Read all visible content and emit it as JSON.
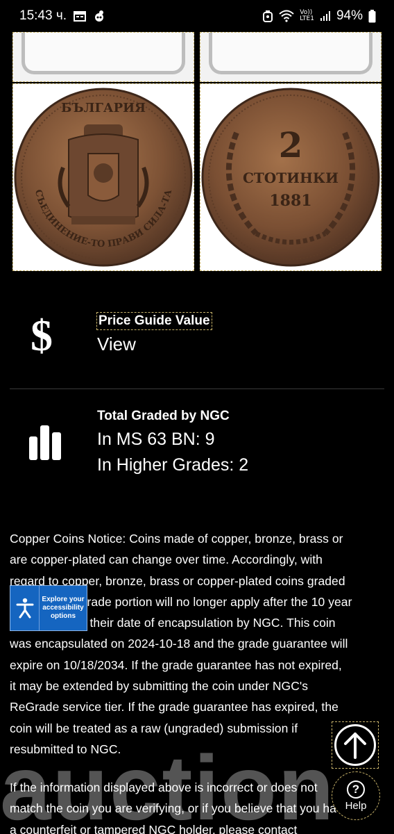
{
  "status_bar": {
    "time": "15:43 ч.",
    "network_top": "Vo))",
    "network_bottom": "LTE1",
    "battery": "94%"
  },
  "coin": {
    "obverse_legend": "БЪЛГАРИЯ",
    "obverse_motto": "СЪЕДИНЕНИЕ-ТО ПРАВИ СИЛА-ТА",
    "reverse_value": "2",
    "reverse_denomination": "СТОТИНКИ",
    "reverse_year": "1881"
  },
  "price_guide": {
    "title": "Price Guide Value",
    "link": "View",
    "icon": "dollar-icon"
  },
  "graded": {
    "title": "Total Graded by NGC",
    "line1": "In MS 63 BN: 9",
    "line2": "In Higher Grades: 2",
    "icon": "bar-chart-icon"
  },
  "notice": {
    "line1": "Copper Coins Notice: Coins made of copper, bronze, brass or",
    "line2": "are copper-plated can change over time. Accordingly, with",
    "line3": "regard to copper, bronze, brass or copper-plated coins graded",
    "line4": "by NGC, the grade portion will no longer apply after the 10 year",
    "line5": "anniversary of their date of encapsulation by NGC. This coin",
    "line6": "was encapsulated on 2024-10-18 and the grade guarantee will",
    "line7": "expire on 10/18/2034. If the grade guarantee has not expired,",
    "line8": "it may be extended by submitting the coin under NGC's",
    "line9": "ReGrade service tier. If the grade guarantee has expired, the",
    "line10": "coin will be treated as a raw (ungraded) submission if",
    "line11": "resubmitted to NGC."
  },
  "notice2": {
    "line1": "If the information displayed above is incorrect or does not",
    "line2": "match the coin you are verifying, or if you believe that you have",
    "line3": "a counterfeit or tampered NGC holder, please contact"
  },
  "watermark": "auction",
  "accessibility": {
    "label": "Explore your accessibility options"
  },
  "help": {
    "label": "Help"
  },
  "colors": {
    "background": "#000000",
    "accessibility_blue": "#1565c0",
    "coin_copper": "#8a5a3a"
  }
}
